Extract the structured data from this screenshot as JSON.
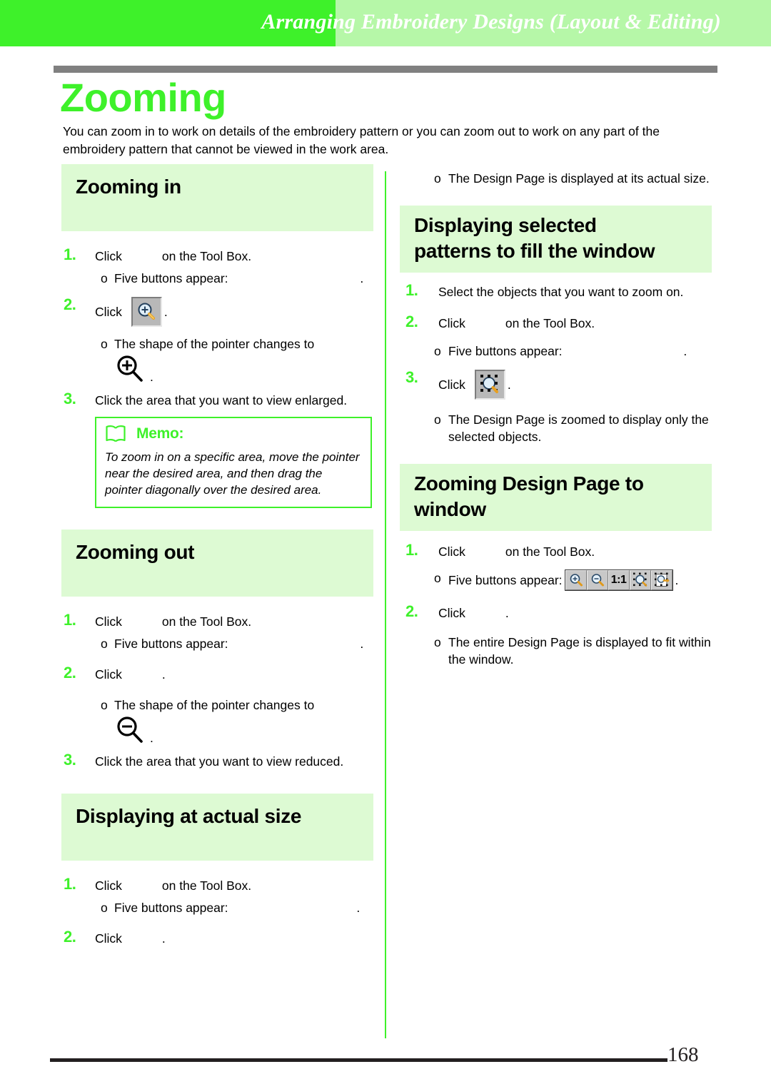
{
  "header": {
    "title": "Arranging Embroidery Designs (Layout & Editing)",
    "band_color": "#3ef12a",
    "band_light_color": "#b6f7a8"
  },
  "page": {
    "title": "Zooming",
    "title_color": "#3ef12a",
    "intro": "You can zoom in to work on details of the embroidery pattern or you can zoom out to work on any part of the embroidery pattern that cannot be viewed in the work area.",
    "number": "168"
  },
  "toolbar": {
    "ratio_label": "1:1",
    "buttons": [
      {
        "name": "zoom-in-button"
      },
      {
        "name": "zoom-out-button"
      },
      {
        "name": "actual-size-button"
      },
      {
        "name": "zoom-to-selection-button"
      },
      {
        "name": "zoom-to-page-button"
      }
    ]
  },
  "left_column": {
    "sections": [
      {
        "id": "zooming-in",
        "heading": "Zooming in",
        "steps": [
          {
            "num": "1.",
            "text_before": "Click",
            "text_after": "on the Tool Box."
          },
          {
            "num": "2.",
            "text_before": "Click",
            "text_after": "."
          }
        ],
        "subs": [
          {
            "bullet": "o",
            "text": "Five buttons appear:",
            "trailing": "."
          },
          {
            "bullet": "o",
            "text": "The shape of the pointer changes to"
          }
        ],
        "step3": {
          "num": "3.",
          "text": "Click the area that you want to view enlarged."
        }
      },
      {
        "id": "zooming-out",
        "heading": "Zooming out",
        "steps": [
          {
            "num": "1.",
            "text_before": "Click",
            "text_after": "on the Tool Box."
          },
          {
            "num": "2.",
            "text_before": "Click",
            "text_after": "."
          }
        ],
        "subs": [
          {
            "bullet": "o",
            "text": "Five buttons appear:",
            "trailing": "."
          },
          {
            "bullet": "o",
            "text": "The shape of the pointer changes to"
          }
        ],
        "step3": {
          "num": "3.",
          "text": "Click the area that you want to view reduced."
        }
      },
      {
        "id": "displaying-actual-size",
        "heading": "Displaying at actual size",
        "steps": [
          {
            "num": "1.",
            "text_before": "Click",
            "text_after": "on the Tool Box."
          },
          {
            "num": "2.",
            "text_before": "Click",
            "text_after": "."
          }
        ],
        "subs": [
          {
            "bullet": "o",
            "text": "Five buttons appear:",
            "trailing": "."
          }
        ]
      }
    ],
    "memo": {
      "title": "Memo:",
      "text": "To zoom in on a specific area, move the pointer near the desired area, and then drag the pointer diagonally over the desired area."
    }
  },
  "right_column": {
    "top_sub": {
      "bullet": "o",
      "text": "The Design Page is displayed at its actual size."
    },
    "sections": [
      {
        "id": "displaying-selected-patterns",
        "heading_line1": "Displaying selected",
        "heading_line2": "patterns to fill the window",
        "step1": {
          "num": "1.",
          "text": "Select the objects that you want to zoom on."
        },
        "step2": {
          "num": "2.",
          "text_before": "Click",
          "text_after": "on the Tool Box."
        },
        "sub1": {
          "bullet": "o",
          "text": "Five buttons appear:",
          "trailing": "."
        },
        "step3": {
          "num": "3.",
          "text_before": "Click",
          "text_after": "."
        },
        "sub2": {
          "bullet": "o",
          "text": "The Design Page is zoomed to display only the selected objects."
        }
      },
      {
        "id": "zooming-design-page-to-window",
        "heading_line1": "Zooming Design Page to",
        "heading_line2": "window",
        "step1": {
          "num": "1.",
          "text_before": "Click",
          "text_after": "on the Tool Box."
        },
        "sub1": {
          "bullet": "o",
          "text": "Five buttons appear:",
          "trailing": "."
        },
        "step2": {
          "num": "2.",
          "text_before": "Click",
          "text_after": "."
        },
        "sub2": {
          "bullet": "o",
          "text": "The entire Design Page is displayed to fit within the window."
        }
      }
    ]
  }
}
